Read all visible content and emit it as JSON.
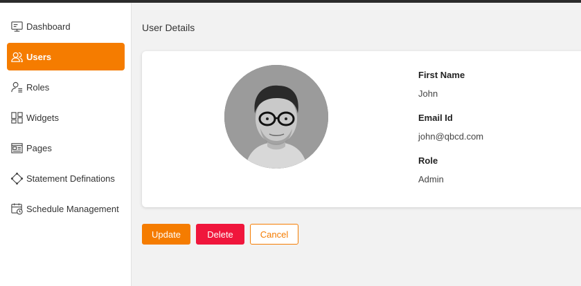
{
  "sidebar": {
    "items": [
      {
        "label": "Dashboard",
        "icon": "dashboard-icon",
        "active": false
      },
      {
        "label": "Users",
        "icon": "users-icon",
        "active": true
      },
      {
        "label": "Roles",
        "icon": "roles-icon",
        "active": false
      },
      {
        "label": "Widgets",
        "icon": "widgets-icon",
        "active": false
      },
      {
        "label": "Pages",
        "icon": "pages-icon",
        "active": false
      },
      {
        "label": "Statement Definations",
        "icon": "statement-icon",
        "active": false
      },
      {
        "label": "Schedule Management",
        "icon": "schedule-icon",
        "active": false
      }
    ]
  },
  "main": {
    "title": "User Details",
    "user": {
      "first_name_label": "First Name",
      "first_name": "John",
      "email_label": "Email Id",
      "email": "john@qbcd.com",
      "role_label": "Role",
      "role": "Admin"
    },
    "actions": {
      "update": "Update",
      "delete": "Delete",
      "cancel": "Cancel"
    }
  },
  "colors": {
    "accent": "#f57c00",
    "danger": "#f0163c"
  }
}
